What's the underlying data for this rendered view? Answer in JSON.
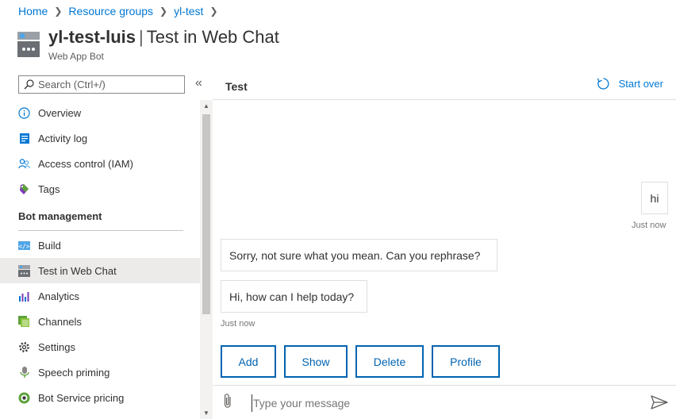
{
  "breadcrumb": {
    "items": [
      "Home",
      "Resource groups",
      "yl-test"
    ]
  },
  "header": {
    "name": "yl-test-luis",
    "page": "Test in Web Chat",
    "subtitle": "Web App Bot"
  },
  "sidebar": {
    "search_placeholder": "Search (Ctrl+/)",
    "items": [
      {
        "label": "Overview",
        "icon": "info-icon"
      },
      {
        "label": "Activity log",
        "icon": "activity-log-icon"
      },
      {
        "label": "Access control (IAM)",
        "icon": "people-icon"
      },
      {
        "label": "Tags",
        "icon": "tag-icon"
      }
    ],
    "section": "Bot management",
    "bot_items": [
      {
        "label": "Build",
        "icon": "code-icon"
      },
      {
        "label": "Test in Web Chat",
        "icon": "bot-icon",
        "active": true
      },
      {
        "label": "Analytics",
        "icon": "analytics-icon"
      },
      {
        "label": "Channels",
        "icon": "channels-icon"
      },
      {
        "label": "Settings",
        "icon": "gear-icon"
      },
      {
        "label": "Speech priming",
        "icon": "microphone-icon"
      },
      {
        "label": "Bot Service pricing",
        "icon": "pricing-icon"
      }
    ]
  },
  "chat": {
    "title": "Test",
    "start_over": "Start over",
    "messages": [
      {
        "from": "user",
        "text": "hi",
        "time": "Just now"
      },
      {
        "from": "bot",
        "text": "Sorry, not sure what you mean. Can you rephrase?"
      },
      {
        "from": "bot",
        "text": "Hi, how can I help today?",
        "time": "Just now"
      }
    ],
    "actions": [
      "Add",
      "Show",
      "Delete",
      "Profile"
    ],
    "input_placeholder": "Type your message"
  },
  "colors": {
    "accent": "#0078d4",
    "button_border": "#0063b1"
  }
}
